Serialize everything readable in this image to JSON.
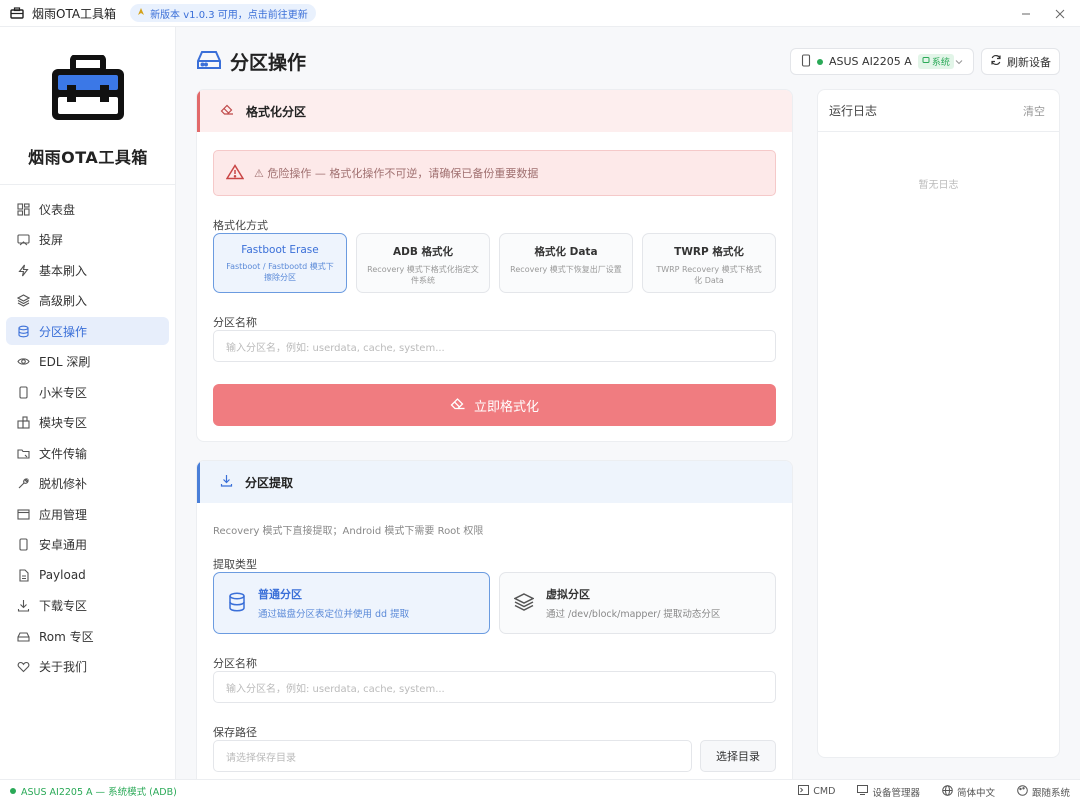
{
  "app": {
    "title": "烟雨OTA工具箱",
    "update_notice": "新版本 v1.0.3 可用，点击前往更新",
    "brand": "烟雨OTA工具箱"
  },
  "sidebar": {
    "items": [
      {
        "label": "仪表盘",
        "icon": "dashboard-icon"
      },
      {
        "label": "投屏",
        "icon": "cast-icon"
      },
      {
        "label": "基本刷入",
        "icon": "bolt-icon"
      },
      {
        "label": "高级刷入",
        "icon": "layers-icon"
      },
      {
        "label": "分区操作",
        "icon": "database-icon",
        "active": true
      },
      {
        "label": "EDL 深刷",
        "icon": "eye-icon"
      },
      {
        "label": "小米专区",
        "icon": "phone-icon"
      },
      {
        "label": "模块专区",
        "icon": "puzzle-icon"
      },
      {
        "label": "文件传输",
        "icon": "folder-icon"
      },
      {
        "label": "脱机修补",
        "icon": "wrench-icon"
      },
      {
        "label": "应用管理",
        "icon": "window-icon"
      },
      {
        "label": "安卓通用",
        "icon": "phone-icon"
      },
      {
        "label": "Payload",
        "icon": "payload-icon"
      },
      {
        "label": "下载专区",
        "icon": "download-icon"
      },
      {
        "label": "Rom 专区",
        "icon": "drive-icon"
      },
      {
        "label": "关于我们",
        "icon": "heart-icon"
      }
    ]
  },
  "header": {
    "title": "分区操作",
    "device": "ASUS AI2205 A",
    "device_badge": "系统",
    "refresh_label": "刷新设备"
  },
  "format": {
    "title": "格式化分区",
    "warning": "⚠ 危险操作 — 格式化操作不可逆，请确保已备份重要数据",
    "method_label": "格式化方式",
    "methods": [
      {
        "title": "Fastboot Erase",
        "desc": "Fastboot / Fastbootd 模式下擦除分区"
      },
      {
        "title": "ADB 格式化",
        "desc": "Recovery 模式下格式化指定文件系统"
      },
      {
        "title": "格式化 Data",
        "desc": "Recovery 模式下恢复出厂设置"
      },
      {
        "title": "TWRP 格式化",
        "desc": "TWRP Recovery 模式下格式化 Data"
      }
    ],
    "partition_label": "分区名称",
    "partition_placeholder": "输入分区名，例如: userdata, cache, system...",
    "action_label": "立即格式化"
  },
  "extract": {
    "title": "分区提取",
    "hint": "Recovery 模式下直接提取；Android 模式下需要 Root 权限",
    "type_label": "提取类型",
    "types": [
      {
        "title": "普通分区",
        "desc": "通过磁盘分区表定位并使用 dd 提取"
      },
      {
        "title": "虚拟分区",
        "desc": "通过 /dev/block/mapper/ 提取动态分区"
      }
    ],
    "partition_label": "分区名称",
    "partition_placeholder": "输入分区名，例如: userdata, cache, system...",
    "save_label": "保存路径",
    "save_placeholder": "请选择保存目录",
    "pick_label": "选择目录"
  },
  "log": {
    "title": "运行日志",
    "clear": "清空",
    "empty": "暂无日志"
  },
  "status": {
    "left": "ASUS AI2205 A  —  系统模式 (ADB)",
    "cmd": "CMD",
    "device_manager": "设备管理器",
    "language": "简体中文",
    "theme": "跟随系统"
  },
  "colors": {
    "accent": "#3a6fd8",
    "danger": "#f07c80",
    "success": "#2aa957"
  }
}
